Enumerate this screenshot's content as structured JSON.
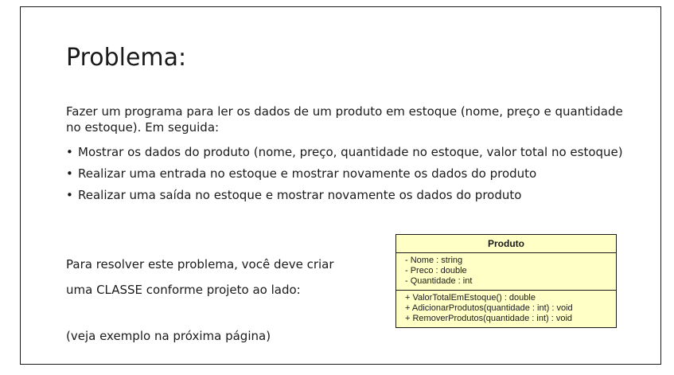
{
  "title": "Problema:",
  "intro": "Fazer um programa para ler os dados de um produto em estoque (nome, preço e quantidade no estoque). Em seguida:",
  "bullets": [
    "Mostrar os dados do produto (nome, preço, quantidade no estoque, valor total no estoque)",
    "Realizar uma entrada no estoque e mostrar novamente os dados do produto",
    "Realizar uma saída no estoque e mostrar novamente os dados do produto"
  ],
  "bullet_symbol": "•",
  "side_text": {
    "line1": "Para resolver este problema, você deve criar",
    "line2": "uma CLASSE conforme projeto ao lado:",
    "note": "(veja exemplo na próxima página)"
  },
  "uml": {
    "class_name": "Produto",
    "attributes": [
      "- Nome : string",
      "- Preco : double",
      "- Quantidade : int"
    ],
    "methods": [
      "+ ValorTotalEmEstoque() : double",
      "+ AdicionarProdutos(quantidade : int) : void",
      "+ RemoverProdutos(quantidade : int) : void"
    ],
    "fill_color": "#ffffc6"
  }
}
